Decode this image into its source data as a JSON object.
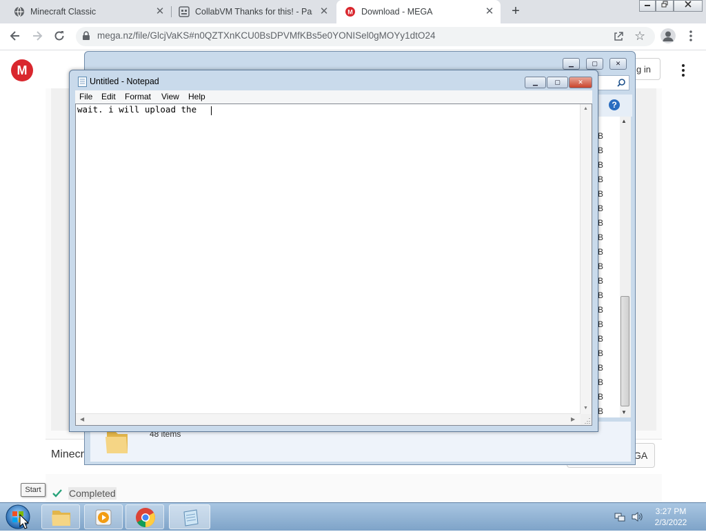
{
  "browser": {
    "tabs": [
      {
        "title": "Minecraft Classic"
      },
      {
        "title": "CollabVM Thanks for this! - Paste"
      },
      {
        "title": "Download - MEGA",
        "active": true
      }
    ],
    "new_tab": "+",
    "url": "mega.nz/file/GlcjVaKS#n0QZTXnKCU0BsDPVMfKBs5e0YONISel0gMOYy1dtO24",
    "caption": {
      "minimize": "▭",
      "maximize": "❐",
      "close": "✕"
    }
  },
  "mega": {
    "logo": "M",
    "login_fragment": "g in",
    "folder_count": "48 items",
    "folder_name_fragment": "Minecr",
    "button_fragment": "GA",
    "download_status": "Completed",
    "size_glyph": "B"
  },
  "notepad": {
    "title": "Untitled - Notepad",
    "menu": [
      "File",
      "Edit",
      "Format",
      "View",
      "Help"
    ],
    "content": "wait. i will upload the "
  },
  "taskbar": {
    "start_tooltip": "Start",
    "time": "3:27 PM",
    "date": "2/3/2022"
  }
}
